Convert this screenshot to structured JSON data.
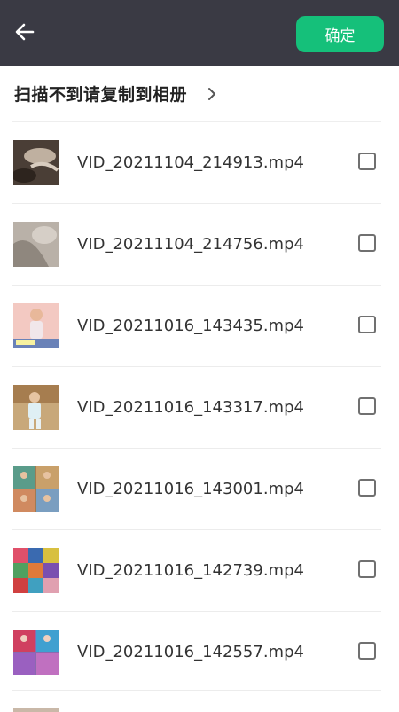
{
  "header": {
    "back_icon": "arrow-left-icon",
    "confirm_label": "确定",
    "background": "#3a3a44",
    "accent": "#15c07a"
  },
  "hint": {
    "text": "扫描不到请复制到相册",
    "chevron_icon": "chevron-right-icon"
  },
  "files": [
    {
      "name": "VID_20211104_214913.mp4",
      "checked": false
    },
    {
      "name": "VID_20211104_214756.mp4",
      "checked": false
    },
    {
      "name": "VID_20211016_143435.mp4",
      "checked": false
    },
    {
      "name": "VID_20211016_143317.mp4",
      "checked": false
    },
    {
      "name": "VID_20211016_143001.mp4",
      "checked": false
    },
    {
      "name": "VID_20211016_142739.mp4",
      "checked": false
    },
    {
      "name": "VID_20211016_142557.mp4",
      "checked": false
    }
  ]
}
